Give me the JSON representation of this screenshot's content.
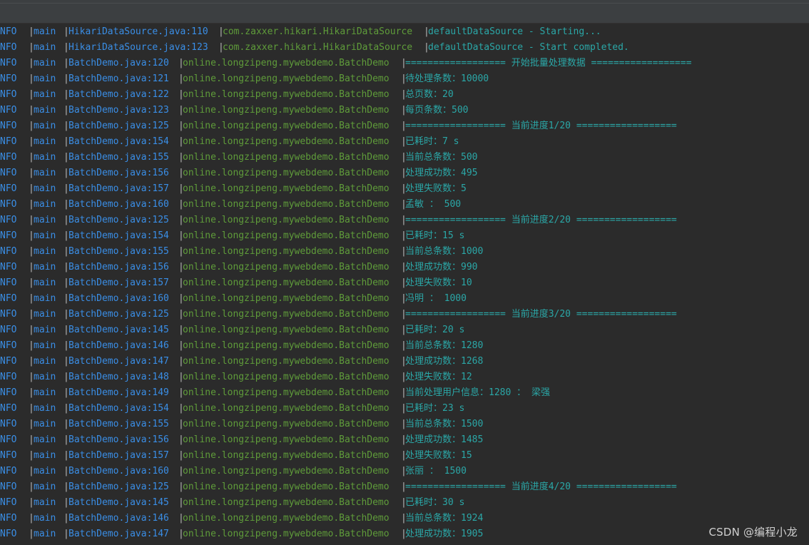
{
  "toolbar": {},
  "log_lines": [
    {
      "level": "NFO",
      "thread": "main",
      "location": "HikariDataSource.java:110",
      "class": "com.zaxxer.hikari.HikariDataSource",
      "message": "defaultDataSource - Starting..."
    },
    {
      "level": "NFO",
      "thread": "main",
      "location": "HikariDataSource.java:123",
      "class": "com.zaxxer.hikari.HikariDataSource",
      "message": "defaultDataSource - Start completed."
    },
    {
      "level": "NFO",
      "thread": "main",
      "location": "BatchDemo.java:120",
      "class": "online.longzipeng.mywebdemo.BatchDemo",
      "message": "================== 开始批量处理数据 =================="
    },
    {
      "level": "NFO",
      "thread": "main",
      "location": "BatchDemo.java:121",
      "class": "online.longzipeng.mywebdemo.BatchDemo",
      "message": "待处理条数：10000"
    },
    {
      "level": "NFO",
      "thread": "main",
      "location": "BatchDemo.java:122",
      "class": "online.longzipeng.mywebdemo.BatchDemo",
      "message": "总页数：20"
    },
    {
      "level": "NFO",
      "thread": "main",
      "location": "BatchDemo.java:123",
      "class": "online.longzipeng.mywebdemo.BatchDemo",
      "message": "每页条数：500"
    },
    {
      "level": "NFO",
      "thread": "main",
      "location": "BatchDemo.java:125",
      "class": "online.longzipeng.mywebdemo.BatchDemo",
      "message": "================== 当前进度1/20 =================="
    },
    {
      "level": "NFO",
      "thread": "main",
      "location": "BatchDemo.java:154",
      "class": "online.longzipeng.mywebdemo.BatchDemo",
      "message": "已耗时：7 s"
    },
    {
      "level": "NFO",
      "thread": "main",
      "location": "BatchDemo.java:155",
      "class": "online.longzipeng.mywebdemo.BatchDemo",
      "message": "当前总条数：500"
    },
    {
      "level": "NFO",
      "thread": "main",
      "location": "BatchDemo.java:156",
      "class": "online.longzipeng.mywebdemo.BatchDemo",
      "message": "处理成功数：495"
    },
    {
      "level": "NFO",
      "thread": "main",
      "location": "BatchDemo.java:157",
      "class": "online.longzipeng.mywebdemo.BatchDemo",
      "message": "处理失败数：5"
    },
    {
      "level": "NFO",
      "thread": "main",
      "location": "BatchDemo.java:160",
      "class": "online.longzipeng.mywebdemo.BatchDemo",
      "message": "孟敏 ： 500"
    },
    {
      "level": "NFO",
      "thread": "main",
      "location": "BatchDemo.java:125",
      "class": "online.longzipeng.mywebdemo.BatchDemo",
      "message": "================== 当前进度2/20 =================="
    },
    {
      "level": "NFO",
      "thread": "main",
      "location": "BatchDemo.java:154",
      "class": "online.longzipeng.mywebdemo.BatchDemo",
      "message": "已耗时：15 s"
    },
    {
      "level": "NFO",
      "thread": "main",
      "location": "BatchDemo.java:155",
      "class": "online.longzipeng.mywebdemo.BatchDemo",
      "message": "当前总条数：1000"
    },
    {
      "level": "NFO",
      "thread": "main",
      "location": "BatchDemo.java:156",
      "class": "online.longzipeng.mywebdemo.BatchDemo",
      "message": "处理成功数：990"
    },
    {
      "level": "NFO",
      "thread": "main",
      "location": "BatchDemo.java:157",
      "class": "online.longzipeng.mywebdemo.BatchDemo",
      "message": "处理失败数：10"
    },
    {
      "level": "NFO",
      "thread": "main",
      "location": "BatchDemo.java:160",
      "class": "online.longzipeng.mywebdemo.BatchDemo",
      "message": "冯明 ： 1000"
    },
    {
      "level": "NFO",
      "thread": "main",
      "location": "BatchDemo.java:125",
      "class": "online.longzipeng.mywebdemo.BatchDemo",
      "message": "================== 当前进度3/20 =================="
    },
    {
      "level": "NFO",
      "thread": "main",
      "location": "BatchDemo.java:145",
      "class": "online.longzipeng.mywebdemo.BatchDemo",
      "message": "已耗时：20 s"
    },
    {
      "level": "NFO",
      "thread": "main",
      "location": "BatchDemo.java:146",
      "class": "online.longzipeng.mywebdemo.BatchDemo",
      "message": "当前总条数：1280"
    },
    {
      "level": "NFO",
      "thread": "main",
      "location": "BatchDemo.java:147",
      "class": "online.longzipeng.mywebdemo.BatchDemo",
      "message": "处理成功数：1268"
    },
    {
      "level": "NFO",
      "thread": "main",
      "location": "BatchDemo.java:148",
      "class": "online.longzipeng.mywebdemo.BatchDemo",
      "message": "处理失败数：12"
    },
    {
      "level": "NFO",
      "thread": "main",
      "location": "BatchDemo.java:149",
      "class": "online.longzipeng.mywebdemo.BatchDemo",
      "message": "当前处理用户信息：1280 ： 梁强"
    },
    {
      "level": "NFO",
      "thread": "main",
      "location": "BatchDemo.java:154",
      "class": "online.longzipeng.mywebdemo.BatchDemo",
      "message": "已耗时：23 s"
    },
    {
      "level": "NFO",
      "thread": "main",
      "location": "BatchDemo.java:155",
      "class": "online.longzipeng.mywebdemo.BatchDemo",
      "message": "当前总条数：1500"
    },
    {
      "level": "NFO",
      "thread": "main",
      "location": "BatchDemo.java:156",
      "class": "online.longzipeng.mywebdemo.BatchDemo",
      "message": "处理成功数：1485"
    },
    {
      "level": "NFO",
      "thread": "main",
      "location": "BatchDemo.java:157",
      "class": "online.longzipeng.mywebdemo.BatchDemo",
      "message": "处理失败数：15"
    },
    {
      "level": "NFO",
      "thread": "main",
      "location": "BatchDemo.java:160",
      "class": "online.longzipeng.mywebdemo.BatchDemo",
      "message": "张丽 ： 1500"
    },
    {
      "level": "NFO",
      "thread": "main",
      "location": "BatchDemo.java:125",
      "class": "online.longzipeng.mywebdemo.BatchDemo",
      "message": "================== 当前进度4/20 =================="
    },
    {
      "level": "NFO",
      "thread": "main",
      "location": "BatchDemo.java:145",
      "class": "online.longzipeng.mywebdemo.BatchDemo",
      "message": "已耗时：30 s"
    },
    {
      "level": "NFO",
      "thread": "main",
      "location": "BatchDemo.java:146",
      "class": "online.longzipeng.mywebdemo.BatchDemo",
      "message": "当前总条数：1924"
    },
    {
      "level": "NFO",
      "thread": "main",
      "location": "BatchDemo.java:147",
      "class": "online.longzipeng.mywebdemo.BatchDemo",
      "message": "处理成功数：1905"
    }
  ],
  "watermark": "CSDN @编程小龙",
  "colors": {
    "background": "#2b2b2b",
    "level": "#3a8ee6",
    "class_hikari": "#5f9c3a",
    "class_batch": "#5f9c3a",
    "message": "#2ba7a7",
    "separator": "#b8b8b8"
  }
}
